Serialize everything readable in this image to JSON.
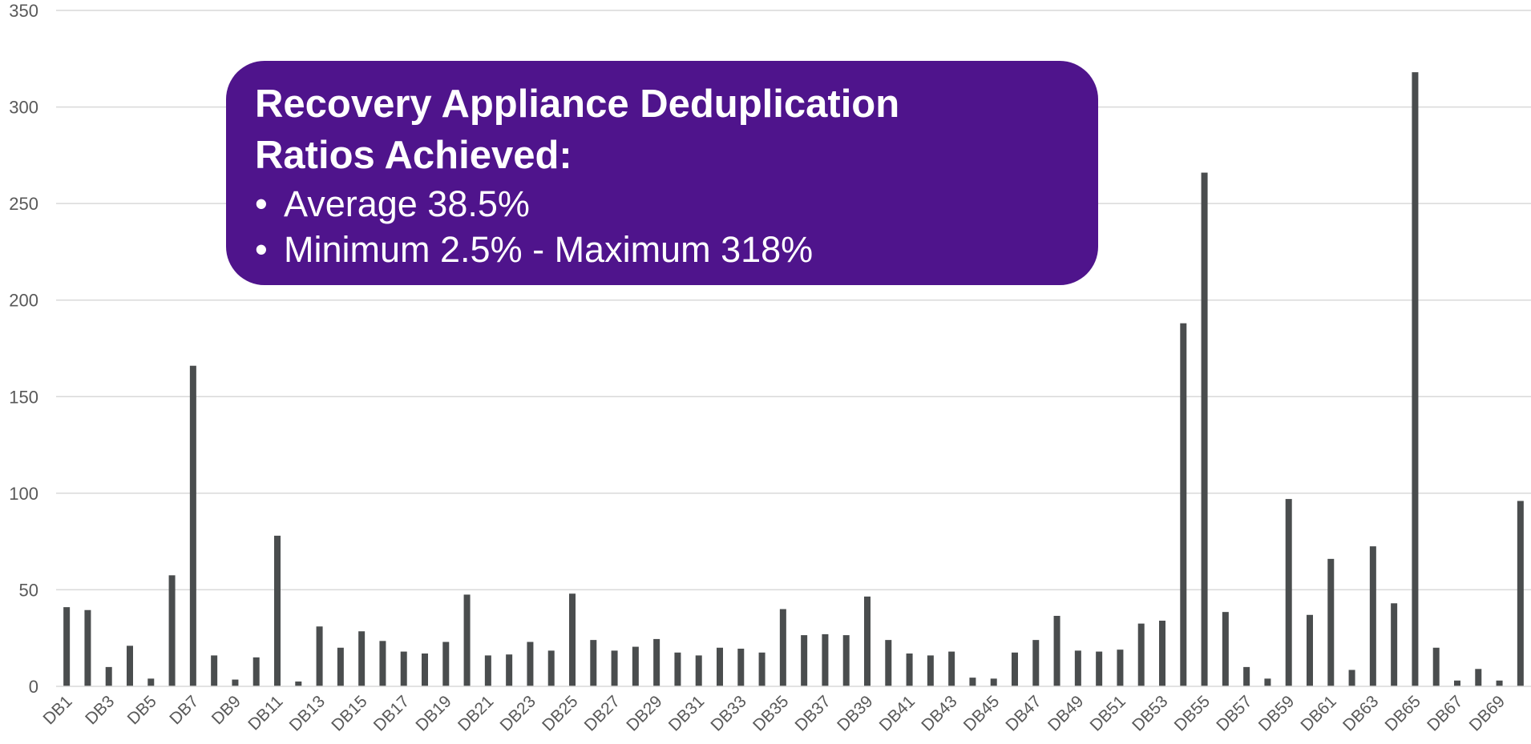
{
  "callout": {
    "title": "Recovery Appliance Deduplication Ratios Achieved:",
    "bullets": [
      "Average 38.5%",
      "Minimum 2.5% - Maximum 318%"
    ],
    "background_color": "#4f148c",
    "text_color": "#ffffff"
  },
  "chart_data": {
    "type": "bar",
    "title": "",
    "xlabel": "",
    "ylabel": "",
    "ylim": [
      0,
      350
    ],
    "yticks": [
      0,
      50,
      100,
      150,
      200,
      250,
      300,
      350
    ],
    "grid": true,
    "bar_color": "#4a4d4e",
    "categories": [
      "DB1",
      "DB2",
      "DB3",
      "DB4",
      "DB5",
      "DB6",
      "DB7",
      "DB8",
      "DB9",
      "DB10",
      "DB11",
      "DB12",
      "DB13",
      "DB14",
      "DB15",
      "DB16",
      "DB17",
      "DB18",
      "DB19",
      "DB20",
      "DB21",
      "DB22",
      "DB23",
      "DB24",
      "DB25",
      "DB26",
      "DB27",
      "DB28",
      "DB29",
      "DB30",
      "DB31",
      "DB32",
      "DB33",
      "DB34",
      "DB35",
      "DB36",
      "DB37",
      "DB38",
      "DB39",
      "DB40",
      "DB41",
      "DB42",
      "DB43",
      "DB44",
      "DB45",
      "DB46",
      "DB47",
      "DB48",
      "DB49",
      "DB50",
      "DB51",
      "DB52",
      "DB53",
      "DB54",
      "DB55",
      "DB56",
      "DB57",
      "DB58",
      "DB59",
      "DB60",
      "DB61",
      "DB62",
      "DB63",
      "DB64",
      "DB65",
      "DB66",
      "DB67",
      "DB68",
      "DB69",
      "DB70"
    ],
    "visible_labels": [
      "DB1",
      "DB3",
      "DB5",
      "DB7",
      "DB9",
      "DB11",
      "DB13",
      "DB15",
      "DB17",
      "DB19",
      "DB21",
      "DB23",
      "DB25",
      "DB27",
      "DB29",
      "DB31",
      "DB33",
      "DB35",
      "DB37",
      "DB39",
      "DB41",
      "DB43",
      "DB45",
      "DB47",
      "DB49",
      "DB51",
      "DB53",
      "DB55",
      "DB57",
      "DB59",
      "DB61",
      "DB63",
      "DB65",
      "DB67",
      "DB69"
    ],
    "values": [
      41,
      39.5,
      10,
      21,
      4,
      57.5,
      166,
      16,
      3.5,
      15,
      78,
      2.5,
      31,
      20,
      28.5,
      23.5,
      18,
      17,
      23,
      47.5,
      16,
      16.5,
      23,
      18.5,
      48,
      24,
      18.5,
      20.5,
      24.5,
      17.5,
      16,
      20,
      19.5,
      17.5,
      40,
      26.5,
      27,
      26.5,
      46.5,
      24,
      17,
      16,
      18,
      4.5,
      4,
      17.5,
      24,
      36.5,
      18.5,
      18,
      19,
      32.5,
      34,
      188,
      266,
      38.5,
      10,
      4,
      97,
      37,
      66,
      8.5,
      72.5,
      43,
      318,
      20,
      3,
      9,
      3,
      96
    ]
  }
}
